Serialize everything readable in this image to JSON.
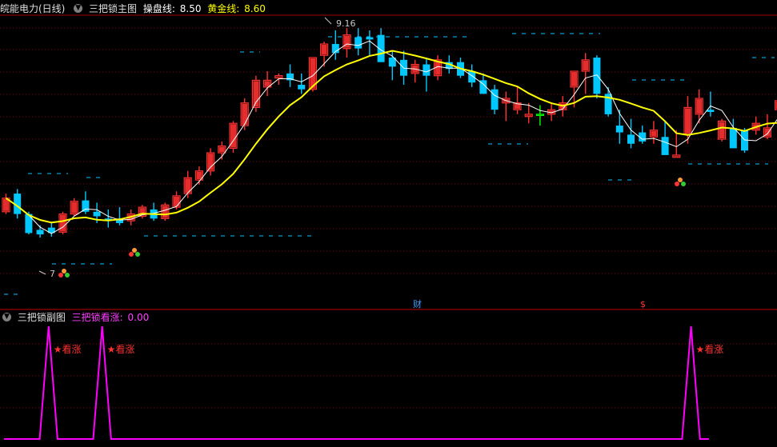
{
  "main_header": {
    "stock": "皖能电力(日线)",
    "indicator": "三把锁主图",
    "line1_label": "操盘线:",
    "line1_value": "8.50",
    "line2_label": "黄金线:",
    "line2_value": "8.60"
  },
  "sub_header": {
    "indicator": "三把锁副图",
    "signal_label": "三把锁看涨:",
    "signal_value": "0.00"
  },
  "annotations": {
    "high_marker": "9.16",
    "low_marker": "7",
    "event_cai": "财",
    "event_dollar": "$",
    "signal_tag": "★看涨"
  },
  "colors": {
    "up": "#ff3232",
    "down": "#00c8ff",
    "cross": "#00ff00",
    "gold_line": "#ffff00",
    "operate_line": "#ffffff",
    "signal_line": "#ff00ff",
    "grid": "#800000",
    "dash_level": "#00c8ff"
  },
  "chart_data": [
    {
      "type": "candlestick",
      "title": "皖能电力(日线)",
      "series": [
        {
          "name": "K",
          "values": [
            [
              7.55,
              7.95,
              7.5,
              7.85
            ],
            [
              7.95,
              8.05,
              7.4,
              7.5
            ],
            [
              7.5,
              7.55,
              7.05,
              7.08
            ],
            [
              7.15,
              7.25,
              6.98,
              7.05
            ],
            [
              7.2,
              7.3,
              7.0,
              7.08
            ],
            [
              7.1,
              7.55,
              7.05,
              7.5
            ],
            [
              7.5,
              7.85,
              7.45,
              7.78
            ],
            [
              7.8,
              8.0,
              7.5,
              7.55
            ],
            [
              7.55,
              7.75,
              7.3,
              7.45
            ],
            [
              7.4,
              7.6,
              7.2,
              7.35
            ],
            [
              7.4,
              7.65,
              7.25,
              7.3
            ],
            [
              7.35,
              7.6,
              7.25,
              7.5
            ],
            [
              7.45,
              7.7,
              7.4,
              7.65
            ],
            [
              7.6,
              7.75,
              7.35,
              7.4
            ],
            [
              7.4,
              7.75,
              7.35,
              7.7
            ],
            [
              7.65,
              8.0,
              7.6,
              7.9
            ],
            [
              7.95,
              8.45,
              7.85,
              8.3
            ],
            [
              8.25,
              8.55,
              8.15,
              8.45
            ],
            [
              8.45,
              8.95,
              8.35,
              8.85
            ],
            [
              8.85,
              9.1,
              8.7,
              9.0
            ],
            [
              8.95,
              9.55,
              8.85,
              9.5
            ],
            [
              9.45,
              10.05,
              9.35,
              9.95
            ],
            [
              9.85,
              10.55,
              9.75,
              10.45
            ],
            [
              10.3,
              10.65,
              10.1,
              10.45
            ],
            [
              10.5,
              10.6,
              10.35,
              10.55
            ],
            [
              10.6,
              10.8,
              10.3,
              10.45
            ],
            [
              10.35,
              10.6,
              10.15,
              10.25
            ],
            [
              10.25,
              10.95,
              10.2,
              10.95
            ],
            [
              11.0,
              11.3,
              10.75,
              11.25
            ],
            [
              11.25,
              11.55,
              10.9,
              11.05
            ],
            [
              11.15,
              11.6,
              10.95,
              11.45
            ],
            [
              11.4,
              11.6,
              11.0,
              11.15
            ],
            [
              11.4,
              11.55,
              11.0,
              11.35
            ],
            [
              11.45,
              11.6,
              10.9,
              10.85
            ],
            [
              10.95,
              11.1,
              10.45,
              10.75
            ],
            [
              10.9,
              11.1,
              10.35,
              10.55
            ],
            [
              10.6,
              10.9,
              10.4,
              10.8
            ],
            [
              10.8,
              10.95,
              10.2,
              10.55
            ],
            [
              10.55,
              11.0,
              10.45,
              10.9
            ],
            [
              10.85,
              11.0,
              10.6,
              10.7
            ],
            [
              10.85,
              10.95,
              10.5,
              10.55
            ],
            [
              10.65,
              10.8,
              10.3,
              10.4
            ],
            [
              10.45,
              10.6,
              10.15,
              10.15
            ],
            [
              10.25,
              10.35,
              9.7,
              9.8
            ],
            [
              9.95,
              10.2,
              9.55,
              10.05
            ],
            [
              9.8,
              10.3,
              9.7,
              9.95
            ],
            [
              9.65,
              9.95,
              9.5,
              9.7
            ],
            [
              9.7,
              9.9,
              9.45,
              9.7
            ],
            [
              9.7,
              9.95,
              9.55,
              9.8
            ],
            [
              9.8,
              10.1,
              9.65,
              9.95
            ],
            [
              10.3,
              10.6,
              9.85,
              10.65
            ],
            [
              10.65,
              11.05,
              10.15,
              10.9
            ],
            [
              10.95,
              11.0,
              10.05,
              10.15
            ],
            [
              10.15,
              10.3,
              9.65,
              9.7
            ],
            [
              9.45,
              9.8,
              9.05,
              9.3
            ],
            [
              9.25,
              9.6,
              8.95,
              9.05
            ],
            [
              9.3,
              9.45,
              9.05,
              9.1
            ],
            [
              9.2,
              9.55,
              9.05,
              9.35
            ],
            [
              9.2,
              9.55,
              8.85,
              8.8
            ],
            [
              8.75,
              9.35,
              8.75,
              8.8
            ],
            [
              9.25,
              10.1,
              9.05,
              9.85
            ],
            [
              9.7,
              10.25,
              9.5,
              10.05
            ],
            [
              9.8,
              10.2,
              9.65,
              9.75
            ],
            [
              9.15,
              9.6,
              9.1,
              9.55
            ],
            [
              9.4,
              9.6,
              9.05,
              8.95
            ],
            [
              9.35,
              9.4,
              8.85,
              8.9
            ],
            [
              9.35,
              9.65,
              9.25,
              9.5
            ],
            [
              9.2,
              9.7,
              9.15,
              9.4
            ],
            [
              9.8,
              10.1,
              9.65,
              10.0
            ],
            [
              9.95,
              10.4,
              9.85,
              10.25
            ],
            [
              10.25,
              10.7,
              10.1,
              10.6
            ],
            [
              10.65,
              10.95,
              10.35,
              10.8
            ],
            [
              10.75,
              10.9,
              10.3,
              10.45
            ],
            [
              10.55,
              10.85,
              10.35,
              10.55
            ],
            [
              10.6,
              10.75,
              10.3,
              10.6
            ],
            [
              10.4,
              10.6,
              10.25,
              10.55
            ]
          ]
        }
      ]
    },
    {
      "type": "line",
      "title": "三把锁副图",
      "series": [
        {
          "name": "三把锁看涨",
          "values": [
            0,
            0,
            0,
            0,
            0,
            1,
            0,
            0,
            0,
            0,
            0,
            1,
            0,
            0,
            0,
            0,
            0,
            0,
            0,
            0,
            0,
            0,
            0,
            0,
            0,
            0,
            0,
            0,
            0,
            0,
            0,
            0,
            0,
            0,
            0,
            0,
            0,
            0,
            0,
            0,
            0,
            0,
            0,
            0,
            0,
            0,
            0,
            0,
            0,
            0,
            0,
            0,
            0,
            0,
            0,
            0,
            0,
            0,
            0,
            0,
            0,
            0,
            0,
            0,
            0,
            0,
            0,
            0,
            0,
            0,
            0,
            0,
            0,
            0,
            0,
            0,
            0,
            1,
            0,
            0
          ]
        }
      ]
    }
  ]
}
